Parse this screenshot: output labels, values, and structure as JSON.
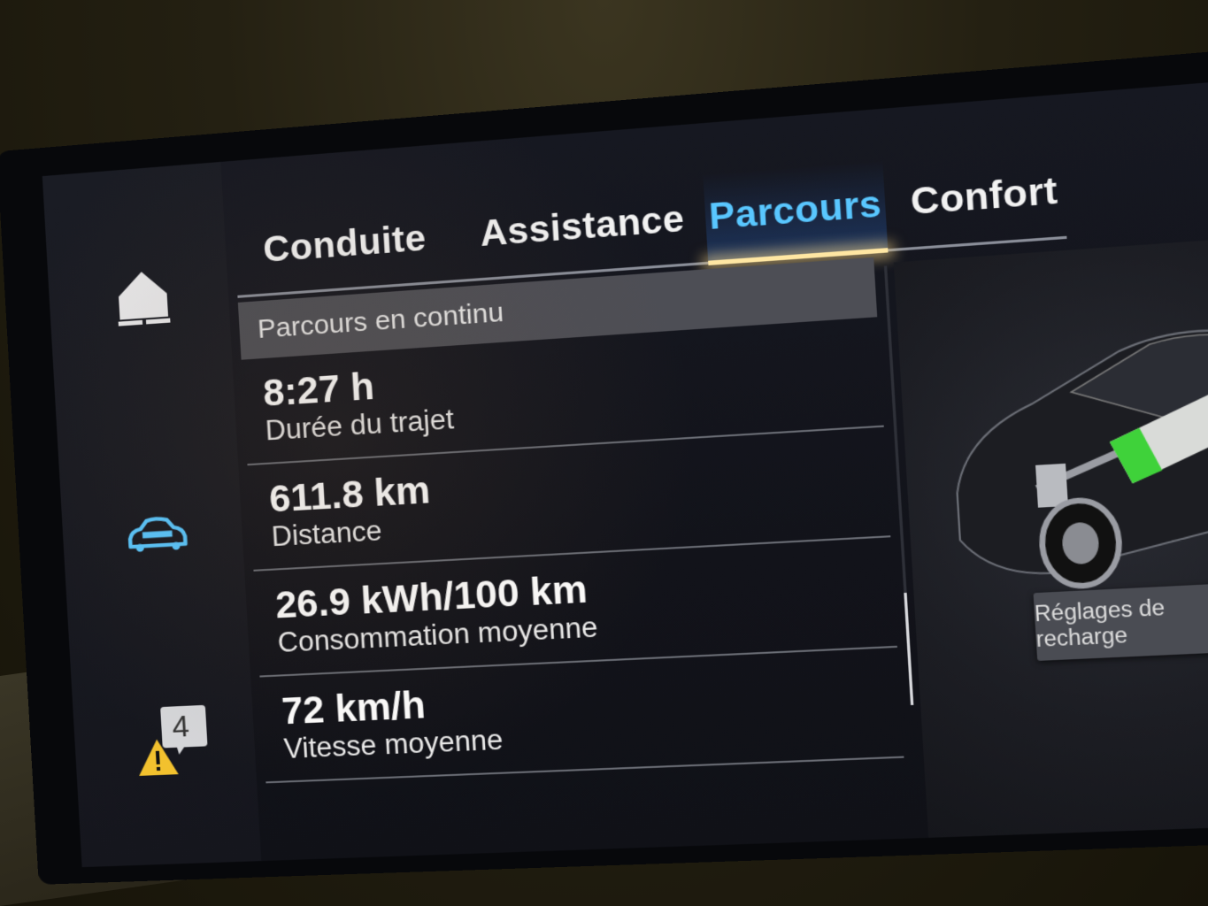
{
  "tabs": [
    {
      "label": "Conduite",
      "active": false
    },
    {
      "label": "Assistance",
      "active": false
    },
    {
      "label": "Parcours",
      "active": true
    },
    {
      "label": "Confort",
      "active": false
    }
  ],
  "list": {
    "header": "Parcours en continu",
    "rows": [
      {
        "value": "8:27 h",
        "label": "Durée du trajet"
      },
      {
        "value": "611.8 km",
        "label": "Distance"
      },
      {
        "value": "26.9 kWh/100 km",
        "label": "Consommation moyenne"
      },
      {
        "value": "72 km/h",
        "label": "Vitesse moyenne"
      }
    ]
  },
  "sidebar": {
    "home_icon": "home-icon",
    "car_icon": "car-icon",
    "warning_icon": "warning-icon",
    "warning_count": "4"
  },
  "right_panel": {
    "charge_button_label": "Réglages de recharge"
  },
  "colors": {
    "accent": "#59c7ff",
    "battery": "#3fd23a"
  }
}
